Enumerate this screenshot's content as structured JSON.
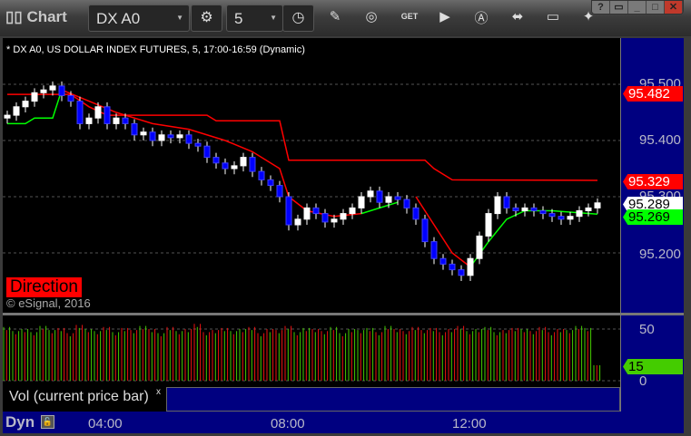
{
  "toolbar": {
    "title": "Chart",
    "symbol": "DX A0",
    "interval": "5"
  },
  "legend": "* DX A0, US DOLLAR INDEX FUTURES, 5, 17:00-16:59 (Dynamic)",
  "price_axis": {
    "ticks": [
      "95.500",
      "95.400",
      "95.300",
      "95.200"
    ],
    "tags": [
      {
        "value": "95.482",
        "bg": "#ff0000",
        "fg": "#ffffff"
      },
      {
        "value": "95.329",
        "bg": "#ff0000",
        "fg": "#ffffff"
      },
      {
        "value": "95.289",
        "bg": "#ffffff",
        "fg": "#000000"
      },
      {
        "value": "95.269",
        "bg": "#00ff00",
        "fg": "#000000"
      }
    ]
  },
  "direction_label": "Direction",
  "copyright": "© eSignal, 2016",
  "volume": {
    "label": "Vol (current price bar)",
    "close_label": "x",
    "ticks": [
      "50",
      "0"
    ],
    "current": "15",
    "current_color": "#44cc00"
  },
  "time_axis": {
    "mode": "Dyn",
    "ticks": [
      "04:00",
      "08:00",
      "12:00"
    ]
  },
  "chart_data": {
    "type": "candlestick",
    "ylim": [
      95.12,
      95.57
    ],
    "closes": [
      95.445,
      95.46,
      95.47,
      95.485,
      95.49,
      95.497,
      95.48,
      95.47,
      95.43,
      95.44,
      95.46,
      95.43,
      95.44,
      95.43,
      95.41,
      95.415,
      95.4,
      95.41,
      95.405,
      95.41,
      95.395,
      95.39,
      95.37,
      95.36,
      95.35,
      95.355,
      95.37,
      95.345,
      95.33,
      95.32,
      95.3,
      95.25,
      95.26,
      95.28,
      95.27,
      95.255,
      95.26,
      95.27,
      95.28,
      95.3,
      95.31,
      95.29,
      95.3,
      95.295,
      95.28,
      95.26,
      95.22,
      95.19,
      95.18,
      95.17,
      95.16,
      95.19,
      95.23,
      95.27,
      95.3,
      95.28,
      95.275,
      95.28,
      95.275,
      95.27,
      95.265,
      95.26,
      95.265,
      95.275,
      95.28,
      95.289
    ],
    "upper_stop": [
      [
        0,
        95.482
      ],
      [
        7,
        95.482
      ],
      [
        9,
        95.46
      ],
      [
        11,
        95.445
      ],
      [
        22,
        95.445
      ],
      [
        23,
        95.435
      ],
      [
        30,
        95.435
      ],
      [
        31,
        95.365
      ],
      [
        46,
        95.365
      ],
      [
        47,
        95.35
      ],
      [
        49,
        95.33
      ],
      [
        65,
        95.329
      ]
    ],
    "trail_green_1": [
      [
        0,
        95.43
      ],
      [
        2,
        95.43
      ],
      [
        3,
        95.44
      ],
      [
        5,
        95.44
      ],
      [
        6,
        95.49
      ]
    ],
    "trail_red_1": [
      [
        6,
        95.49
      ],
      [
        9,
        95.47
      ],
      [
        12,
        95.45
      ],
      [
        16,
        95.43
      ],
      [
        20,
        95.42
      ],
      [
        24,
        95.4
      ],
      [
        27,
        95.38
      ],
      [
        30,
        95.35
      ],
      [
        31,
        95.3
      ],
      [
        33,
        95.275
      ],
      [
        36,
        95.265
      ],
      [
        39,
        95.27
      ]
    ],
    "trail_green_2": [
      [
        39,
        95.27
      ],
      [
        41,
        95.28
      ],
      [
        43,
        95.29
      ]
    ],
    "trail_red_2": [
      [
        45,
        95.3
      ],
      [
        47,
        95.25
      ],
      [
        49,
        95.2
      ],
      [
        51,
        95.175
      ]
    ],
    "trail_green_3": [
      [
        51,
        95.175
      ],
      [
        53,
        95.22
      ],
      [
        55,
        95.26
      ],
      [
        57,
        95.275
      ],
      [
        60,
        95.275
      ],
      [
        65,
        95.269
      ]
    ],
    "volumes": [
      52,
      48,
      50,
      47,
      53,
      49,
      51,
      46,
      54,
      50,
      48,
      52,
      47,
      51,
      49,
      53,
      50,
      46,
      52,
      48,
      50,
      55,
      47,
      49,
      51,
      48,
      50,
      52,
      46,
      50,
      49,
      53,
      47,
      51,
      50,
      48,
      52,
      46,
      50,
      49,
      51,
      47,
      53,
      50,
      48,
      52,
      49,
      51,
      47,
      50,
      53,
      48,
      50,
      52,
      47,
      49,
      51,
      50,
      48,
      52,
      47,
      50,
      49,
      53,
      51,
      15
    ],
    "vol_ylim": [
      0,
      60
    ]
  }
}
